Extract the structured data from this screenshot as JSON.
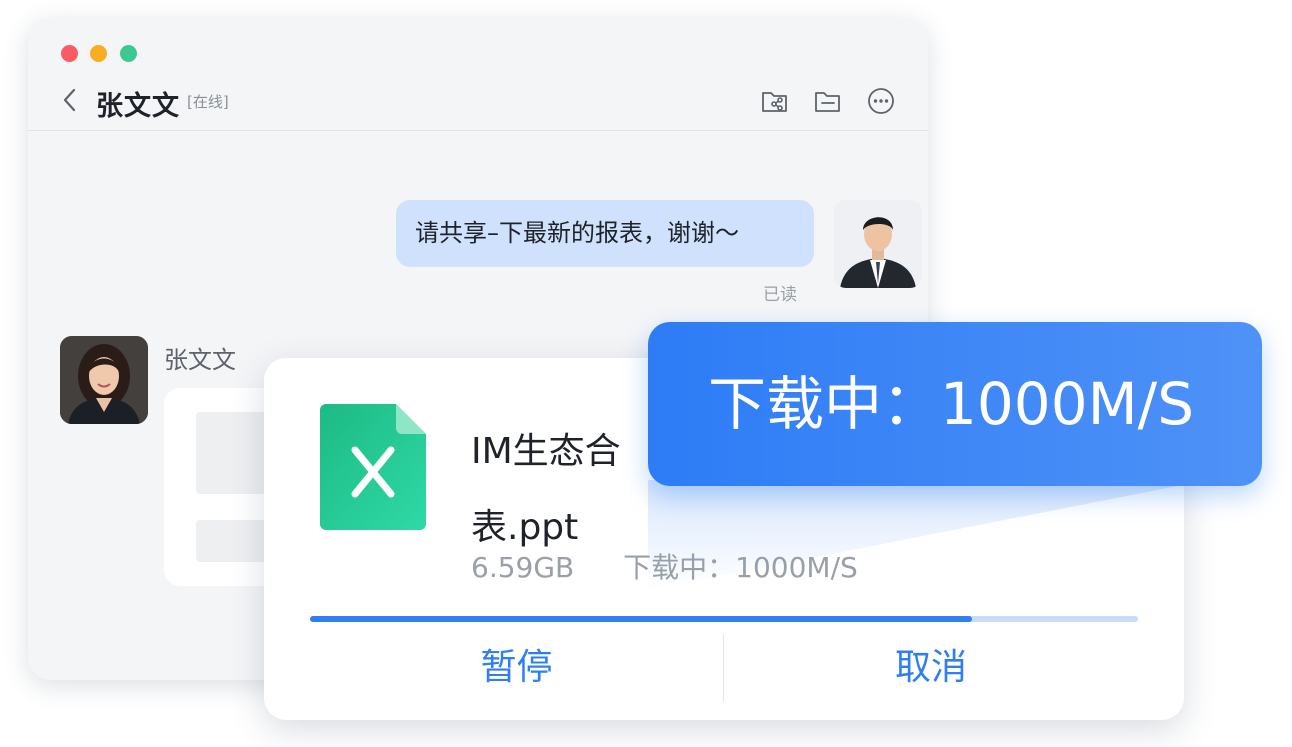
{
  "window": {
    "contact_name": "张文文",
    "contact_status": "[在线]",
    "toolbar_icons": [
      "share-folder-icon",
      "folder-icon",
      "more-icon"
    ]
  },
  "chat": {
    "outgoing_message": "请共享–下最新的报表，谢谢～",
    "read_status": "已读",
    "sender_name": "张文文"
  },
  "download": {
    "file_name": "IM生态合作表.ppt",
    "file_name_line1": "IM生态合",
    "file_name_line2": "表.ppt",
    "file_size": "6.59GB",
    "status": "下载中：1000M/S",
    "progress": 0.8,
    "pause_label": "暂停",
    "cancel_label": "取消",
    "file_icon": "excel-file-icon"
  },
  "callout": {
    "text": "下载中：1000M/S"
  },
  "colors": {
    "accent": "#2f7ff3",
    "bubble": "#cfe1fd",
    "excel_green": "#21c48c"
  }
}
